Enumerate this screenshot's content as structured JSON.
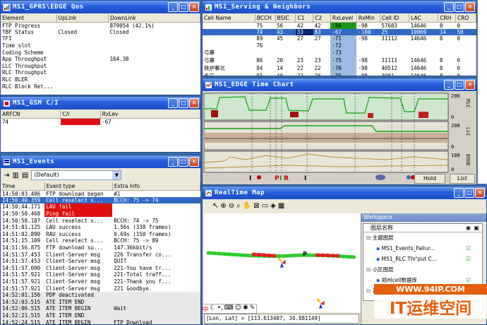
{
  "qos": {
    "title": "MS1_GPRS\\EDGE Qos",
    "columns": [
      "Element",
      "UpLink",
      "DownLink"
    ],
    "rows": [
      [
        "FTP Progress",
        "",
        "879054 (42.1%)"
      ],
      [
        "TBF Status",
        "Closed",
        "Closed"
      ],
      [
        "TFI",
        "",
        ""
      ],
      [
        "Time slot",
        "",
        ""
      ],
      [
        "Coding Scheme",
        "",
        ""
      ],
      [
        "App Throughput",
        "",
        "164.30"
      ],
      [
        "LLC Throughput",
        "",
        ""
      ],
      [
        "RLC Throughput",
        "",
        ""
      ],
      [
        "RLC BLER",
        "",
        ""
      ],
      [
        "RLC Block Ret...",
        "",
        ""
      ]
    ]
  },
  "serving": {
    "title": "MS1_Serving & Neighbors",
    "columns": [
      "Cell Name",
      "BCCH",
      "BSIC",
      "C1",
      "C2",
      "RxLevel",
      "RxMin",
      "Cell ID",
      "LAC",
      "CRH",
      "CRO"
    ],
    "rows": [
      [
        "",
        "75",
        "56",
        "42",
        "42",
        "-56",
        "-98",
        "57683",
        "14646",
        "8",
        "0"
      ],
      [
        "",
        "74",
        "43",
        "33",
        "83",
        "-67",
        "-100",
        "25",
        "10069",
        "14",
        "50"
      ],
      [
        "",
        "89",
        "45",
        "27",
        "27",
        "-71",
        "-98",
        "31112",
        "14646",
        "8",
        "0"
      ],
      [
        "",
        "76",
        "",
        "",
        "",
        "-72",
        "",
        "",
        "",
        "",
        ""
      ],
      [
        "弓寨",
        "",
        "",
        "",
        "",
        "-73",
        "",
        "",
        "",
        "",
        ""
      ],
      [
        "弓寨",
        "86",
        "20",
        "23",
        "23",
        "-75",
        "-98",
        "31111",
        "14646",
        "8",
        "0"
      ],
      [
        "铁炉寨北",
        "84",
        "14",
        "22",
        "22",
        "-76",
        "-98",
        "40512",
        "14646",
        "8",
        "0"
      ],
      [
        "毛庄",
        "91",
        "40",
        "22",
        "26",
        "-76",
        "-98",
        "3001",
        "14646",
        "8",
        "0"
      ]
    ]
  },
  "gsm": {
    "title": "MS1_GSM C/I",
    "columns": [
      "ARFCN",
      "C/I",
      "RxLev"
    ],
    "rows": [
      [
        "74",
        "",
        "-67"
      ]
    ]
  },
  "edge": {
    "title": "MS1_EDGE Time Chart",
    "hold": "Hold",
    "list": "List",
    "axis_labels": [
      "200",
      "0",
      "200",
      "0",
      "100",
      "0"
    ],
    "side_labels": [
      "RLC",
      "LLC",
      "EDGE"
    ]
  },
  "events": {
    "title": "MS1_Events",
    "filter": "(Default)",
    "columns": [
      "Time",
      "Event type",
      "Extra Info"
    ],
    "rows": [
      [
        "14:50:03.406",
        "FTP download began",
        "#1"
      ],
      [
        "14:50:40.359",
        "Cell reselect s...",
        "BCCH: 75 -> 74"
      ],
      [
        "14:50:44.171",
        "LAU fail",
        ""
      ],
      [
        "14:50:50.468",
        "Ping fail",
        ""
      ],
      [
        "14:50:58.187",
        "Cell reselect s...",
        "BCCH: 74 -> 75"
      ],
      [
        "14:51:01.125",
        "LAU success",
        "1.56s (338 frames)"
      ],
      [
        "14:51:02.890",
        "RAU success",
        "0.69s (150 frames)"
      ],
      [
        "14:51:15.109",
        "Cell reselect s...",
        "BCCH: 75 -> 89"
      ],
      [
        "14:51:56.875",
        "FTP download su...",
        "147.36kbit/s"
      ],
      [
        "14:51:57.453",
        "Client-Server msg",
        "226 Transfer co..."
      ],
      [
        "14:51:57.453",
        "Client-Server msg",
        "QUIT"
      ],
      [
        "14:51:57.090",
        "Client-Server msg",
        "221-You have tr..."
      ],
      [
        "14:51:57.921",
        "Client-Server msg",
        "221-Total traff..."
      ],
      [
        "14:51:57.921",
        "Client-Server msg",
        "221-Thank you f..."
      ],
      [
        "14:51:57.921",
        "Client-Server msg",
        "221 Goodbye."
      ],
      [
        "14:52:01.156",
        "PDP deactivated",
        ""
      ],
      [
        "14:52:03.515",
        "ATE ITEM END",
        ""
      ],
      [
        "14:52:06.515",
        "ATE ITEM BEGIN",
        "Wait"
      ],
      [
        "14:52:21.515",
        "ATE ITEM END",
        ""
      ],
      [
        "14:52:24.515",
        "ATE ITEM BEGIN",
        "FTP Download"
      ]
    ]
  },
  "map": {
    "title": "RealTime Map",
    "status": "[Lon, Lat] = [113.613487, 34.881149]",
    "workspace": {
      "title": "Workspace",
      "header": "图层名称",
      "items": [
        {
          "label": "主题图层",
          "level": 0
        },
        {
          "label": "MS1_Events_Failur...",
          "level": 1
        },
        {
          "label": "MS1_RLC Thr'put C...",
          "level": 1
        },
        {
          "label": "小区图层",
          "level": 0
        },
        {
          "label": "郑州cell数据库",
          "level": 1
        },
        {
          "label": "背景图层",
          "level": 0
        }
      ]
    }
  },
  "watermark": {
    "site": "WWW.94IP.COM",
    "brand": "IT运维空间"
  },
  "desktop": {
    "right_edge": [
      "Ce",
      "12",
      "0",
      "0",
      "0"
    ]
  },
  "colors": {
    "title": "#245edb",
    "select": "#316ac5",
    "red": "#e01010",
    "green": "#1a9a1a"
  }
}
